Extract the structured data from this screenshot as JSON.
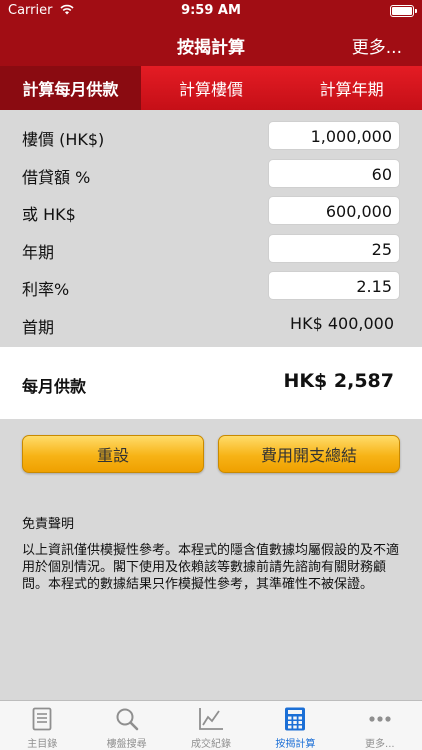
{
  "status_bar": {
    "carrier": "Carrier",
    "time": "9:59 AM"
  },
  "nav": {
    "title": "按揭計算",
    "more": "更多..."
  },
  "segments": [
    {
      "label": "計算每月供款",
      "active": true
    },
    {
      "label": "計算樓價",
      "active": false
    },
    {
      "label": "計算年期",
      "active": false
    }
  ],
  "form": {
    "price_label": "樓價 (HK$)",
    "price_value": "1,000,000",
    "loan_pct_label": "借貸額  %",
    "loan_pct_value": "60",
    "loan_hkd_label": "或 HK$",
    "loan_hkd_value": "600,000",
    "years_label": "年期",
    "years_value": "25",
    "rate_label": "利率%",
    "rate_value": "2.15",
    "downpay_label": "首期",
    "downpay_value": "HK$ 400,000"
  },
  "result": {
    "label": "每月供款",
    "value": "HK$ 2,587"
  },
  "buttons": {
    "reset": "重設",
    "expense_summary": "費用開支總結"
  },
  "disclaimer": {
    "title": "免責聲明",
    "text": "以上資訊僅供模擬性參考。本程式的隱含值數據均屬假設的及不適用於個別情況。閣下使用及依賴該等數據前請先諮詢有關財務顧問。本程式的數據結果只作模擬性參考，其準確性不被保證。"
  },
  "tabs": [
    {
      "label": "主目錄",
      "icon": "book-icon",
      "active": false
    },
    {
      "label": "樓盤搜尋",
      "icon": "search-icon",
      "active": false
    },
    {
      "label": "成交紀錄",
      "icon": "line-chart-icon",
      "active": false
    },
    {
      "label": "按揭計算",
      "icon": "calculator-icon",
      "active": true
    },
    {
      "label": "更多...",
      "icon": "more-dots-icon",
      "active": false
    }
  ],
  "colors": {
    "nav_red": "#a10d14",
    "segment_red": "#e41c24",
    "button_orange": "#f7b316",
    "tab_active_blue": "#1b6fd6"
  }
}
